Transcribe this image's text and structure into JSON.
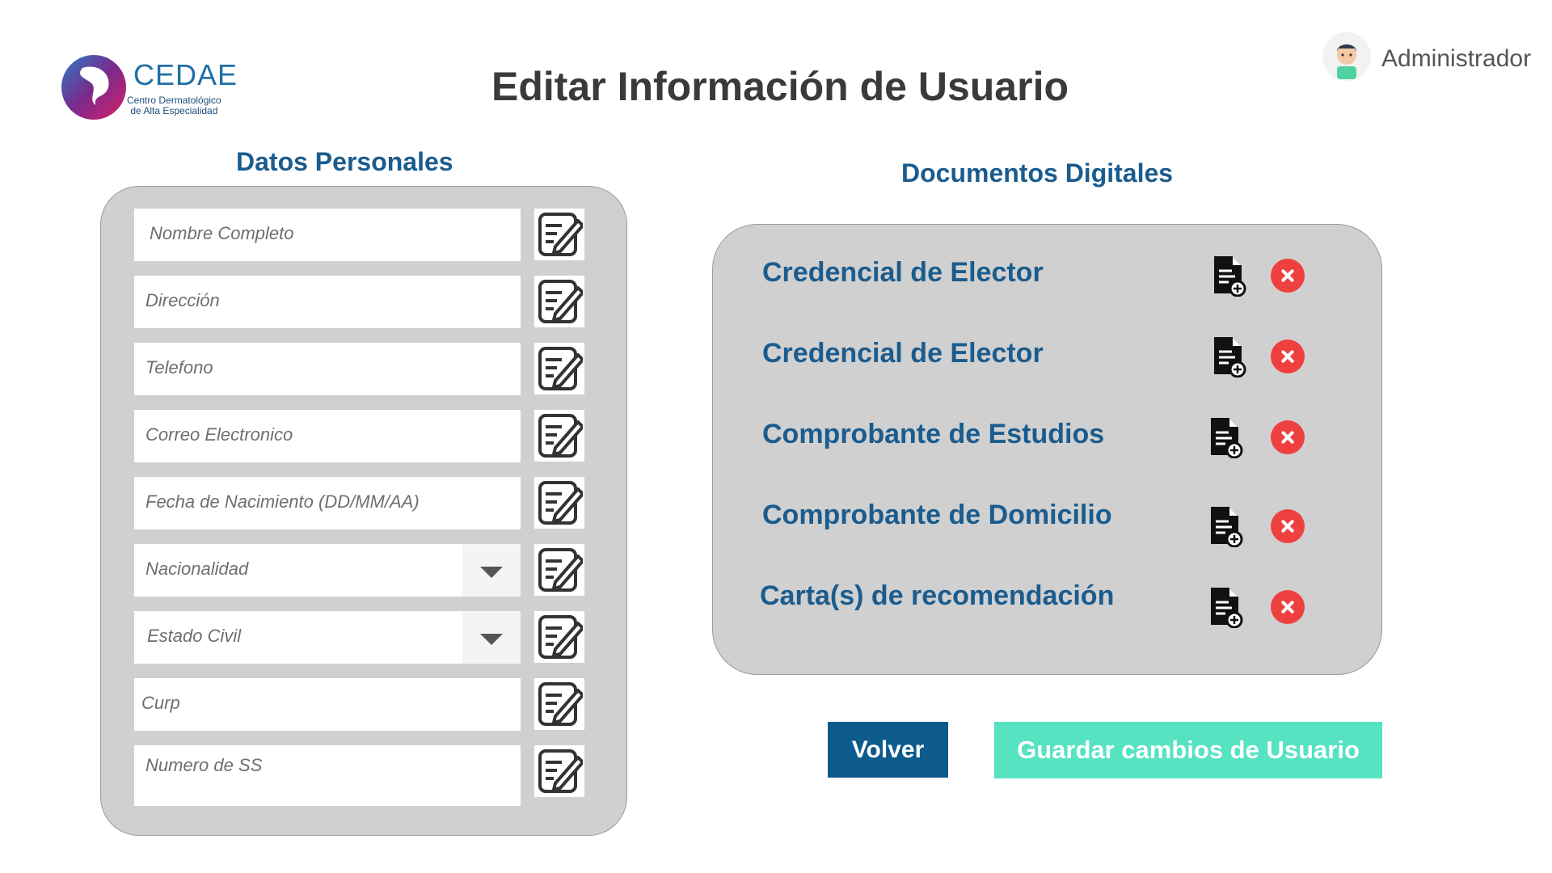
{
  "logo": {
    "name": "CEDAE",
    "subtitle_line1": "Centro Dermatológico",
    "subtitle_line2": "de Alta Especialidad"
  },
  "page_title": "Editar Información de Usuario",
  "user": {
    "name": "Administrador"
  },
  "personal": {
    "title": "Datos Personales",
    "fields": [
      {
        "placeholder": "Nombre Completo",
        "type": "text"
      },
      {
        "placeholder": "Dirección",
        "type": "text"
      },
      {
        "placeholder": "Telefono",
        "type": "text"
      },
      {
        "placeholder": "Correo Electronico",
        "type": "text"
      },
      {
        "placeholder": "Fecha de Nacimiento (DD/MM/AA)",
        "type": "text"
      },
      {
        "placeholder": "Nacionalidad",
        "type": "select"
      },
      {
        "placeholder": "Estado Civil",
        "type": "select"
      },
      {
        "placeholder": "Curp",
        "type": "text"
      },
      {
        "placeholder": "Numero de SS",
        "type": "text"
      }
    ]
  },
  "documents": {
    "title": "Documentos Digitales",
    "items": [
      {
        "label": "Credencial de Elector"
      },
      {
        "label": "Credencial de Elector"
      },
      {
        "label": "Comprobante de Estudios"
      },
      {
        "label": "Comprobante de Domicilio"
      },
      {
        "label": "Carta(s) de recomendación"
      }
    ]
  },
  "actions": {
    "back_label": "Volver",
    "save_label": "Guardar cambios de Usuario"
  },
  "colors": {
    "primary": "#1b5c8e",
    "back_button": "#0d5a8c",
    "save_button": "#55e3c2",
    "delete": "#ef4040",
    "panel": "#d0d0d0"
  }
}
